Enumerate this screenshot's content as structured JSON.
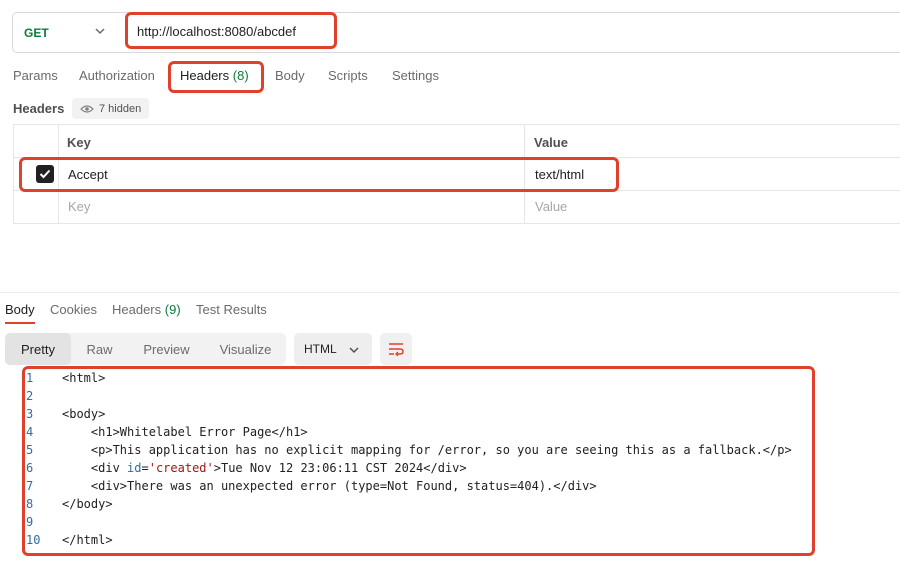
{
  "request": {
    "method": "GET",
    "url": "http://localhost:8080/abcdef",
    "tabs": [
      "Params",
      "Authorization",
      "Headers",
      "Body",
      "Scripts",
      "Settings"
    ],
    "headers_tab_count": "(8)",
    "headers_section_title": "Headers",
    "hidden_label": "7 hidden",
    "table": {
      "col_key": "Key",
      "col_value": "Value",
      "rows": [
        {
          "key": "Accept",
          "value": "text/html",
          "checked": true
        }
      ],
      "key_placeholder": "Key",
      "value_placeholder": "Value"
    }
  },
  "response": {
    "tabs": [
      "Body",
      "Cookies",
      "Headers",
      "Test Results"
    ],
    "headers_count": "(9)",
    "view_modes": [
      "Pretty",
      "Raw",
      "Preview",
      "Visualize"
    ],
    "format": "HTML",
    "code_lines": [
      {
        "n": "1",
        "text": "<html>"
      },
      {
        "n": "2",
        "text": ""
      },
      {
        "n": "3",
        "text": "<body>"
      },
      {
        "n": "4",
        "text": "    <h1>Whitelabel Error Page</h1>"
      },
      {
        "n": "5",
        "text": "    <p>This application has no explicit mapping for /error, so you are seeing this as a fallback.</p>"
      },
      {
        "n": "6",
        "pre": "    <div ",
        "attr": "id",
        "eq": "=",
        "str": "'created'",
        "post": ">Tue Nov 12 23:06:11 CST 2024</div>"
      },
      {
        "n": "7",
        "text": "    <div>There was an unexpected error (type=Not Found, status=404).</div>"
      },
      {
        "n": "8",
        "text": "</body>"
      },
      {
        "n": "9",
        "text": ""
      },
      {
        "n": "10",
        "text": "</html>"
      }
    ]
  },
  "colors": {
    "accent": "#e0412c",
    "method_green": "#0b7a3e",
    "highlight": "#e0412c"
  }
}
